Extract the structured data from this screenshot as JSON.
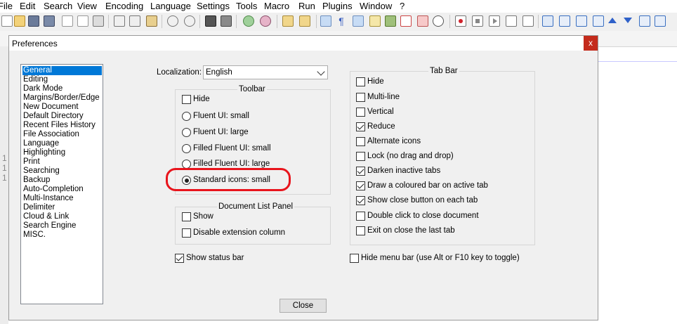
{
  "menubar": {
    "items": [
      "File",
      "Edit",
      "Search",
      "View",
      "Encoding",
      "Language",
      "Settings",
      "Tools",
      "Macro",
      "Run",
      "Plugins",
      "Window",
      "?"
    ]
  },
  "toolbar": {
    "icons": [
      "new-file-icon",
      "open-file-icon",
      "save-icon",
      "save-all-icon",
      "close-icon",
      "close-all-icon",
      "print-icon",
      "cut-icon",
      "copy-icon",
      "paste-icon",
      "undo-icon",
      "redo-icon",
      "find-icon",
      "replace-icon",
      "zoom-in-icon",
      "zoom-out-icon",
      "sync-vertical-icon",
      "sync-horizontal-icon",
      "word-wrap-icon",
      "show-all-chars-icon",
      "indent-guide-icon",
      "doc-map-icon",
      "function-list-icon",
      "folder-workspace-icon",
      "doc-list-icon",
      "monitoring-icon",
      "record-macro-icon",
      "stop-macro-icon",
      "play-macro-icon",
      "run-macro-multiple-icon",
      "save-macro-icon",
      "toolbar-extra-1-icon",
      "toolbar-extra-2-icon",
      "toolbar-extra-3-icon",
      "toolbar-extra-4-icon",
      "toolbar-extra-5-icon",
      "toolbar-extra-6-icon"
    ]
  },
  "editor": {
    "gutter_digits": [
      "1",
      "1",
      "1"
    ]
  },
  "dialog": {
    "title": "Preferences",
    "close_x": "x",
    "categories": [
      "General",
      "Editing",
      "Dark Mode",
      "Margins/Border/Edge",
      "New Document",
      "Default Directory",
      "Recent Files History",
      "File Association",
      "Language",
      "Highlighting",
      "Print",
      "Searching",
      "Backup",
      "Auto-Completion",
      "Multi-Instance",
      "Delimiter",
      "Cloud & Link",
      "Search Engine",
      "MISC."
    ],
    "selected_category": "General",
    "localization": {
      "label": "Localization:",
      "value": "English"
    },
    "toolbar_group": {
      "title": "Toolbar",
      "hide": {
        "label": "Hide",
        "checked": false
      },
      "radios": [
        {
          "label": "Fluent UI: small",
          "selected": false
        },
        {
          "label": "Fluent UI: large",
          "selected": false
        },
        {
          "label": "Filled Fluent UI: small",
          "selected": false
        },
        {
          "label": "Filled Fluent UI: large",
          "selected": false
        },
        {
          "label": "Standard icons: small",
          "selected": true
        }
      ]
    },
    "doclist_group": {
      "title": "Document List Panel",
      "options": [
        {
          "label": "Show",
          "checked": false
        },
        {
          "label": "Disable extension column",
          "checked": false
        }
      ]
    },
    "status_bar": {
      "label": "Show status bar",
      "checked": true
    },
    "tabbar_group": {
      "title": "Tab Bar",
      "options": [
        {
          "label": "Hide",
          "checked": false
        },
        {
          "label": "Multi-line",
          "checked": false
        },
        {
          "label": "Vertical",
          "checked": false
        },
        {
          "label": "Reduce",
          "checked": true
        },
        {
          "label": "Alternate icons",
          "checked": false
        },
        {
          "label": "Lock (no drag and drop)",
          "checked": false
        },
        {
          "label": "Darken inactive tabs",
          "checked": true
        },
        {
          "label": "Draw a coloured bar on active tab",
          "checked": true
        },
        {
          "label": "Show close button on each tab",
          "checked": true
        },
        {
          "label": "Double click to close document",
          "checked": false
        },
        {
          "label": "Exit on close the last tab",
          "checked": false
        }
      ]
    },
    "hide_menu_bar": {
      "label": "Hide menu bar (use Alt or F10 key to toggle)",
      "checked": false
    },
    "close_button": "Close"
  },
  "colors": {
    "selection": "#0078d7",
    "annotation": "#e8141c",
    "close_x_bg": "#c42b1c"
  }
}
